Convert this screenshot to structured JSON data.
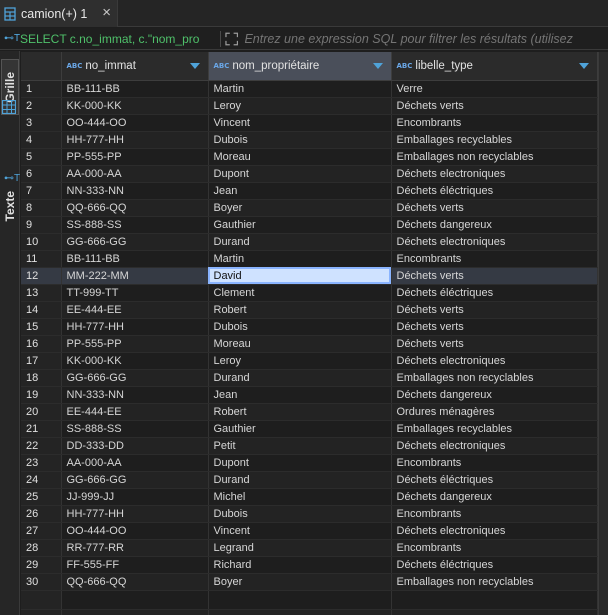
{
  "tab": {
    "label": "camion(+) 1",
    "close": "×"
  },
  "filter": {
    "query": "SELECT c.no_immat, c.\"nom_pro",
    "placeholder": "Entrez une expression SQL pour filtrer les résultats (utilisez",
    "sql_icon": "⊷T"
  },
  "side_tabs": {
    "grid": "Grille",
    "text": "Texte"
  },
  "columns": [
    {
      "name": "no_immat",
      "type_badge": "ABC",
      "selected": false
    },
    {
      "name": "nom_propriétaire",
      "type_badge": "ABC",
      "selected": true
    },
    {
      "name": "libelle_type",
      "type_badge": "ABC",
      "selected": false
    }
  ],
  "active_row": 12,
  "rows": [
    {
      "n": "1",
      "immat": "BB-111-BB",
      "owner": "Martin",
      "type": "Verre"
    },
    {
      "n": "2",
      "immat": "KK-000-KK",
      "owner": "Leroy",
      "type": "Déchets verts"
    },
    {
      "n": "3",
      "immat": "OO-444-OO",
      "owner": "Vincent",
      "type": "Encombrants"
    },
    {
      "n": "4",
      "immat": "HH-777-HH",
      "owner": "Dubois",
      "type": "Emballages recyclables"
    },
    {
      "n": "5",
      "immat": "PP-555-PP",
      "owner": "Moreau",
      "type": "Emballages non recyclables"
    },
    {
      "n": "6",
      "immat": "AA-000-AA",
      "owner": "Dupont",
      "type": "Déchets electroniques"
    },
    {
      "n": "7",
      "immat": "NN-333-NN",
      "owner": "Jean",
      "type": "Déchets éléctriques"
    },
    {
      "n": "8",
      "immat": "QQ-666-QQ",
      "owner": "Boyer",
      "type": "Déchets verts"
    },
    {
      "n": "9",
      "immat": "SS-888-SS",
      "owner": "Gauthier",
      "type": "Déchets dangereux"
    },
    {
      "n": "10",
      "immat": "GG-666-GG",
      "owner": "Durand",
      "type": "Déchets electroniques"
    },
    {
      "n": "11",
      "immat": "BB-111-BB",
      "owner": "Martin",
      "type": "Encombrants"
    },
    {
      "n": "12",
      "immat": "MM-222-MM",
      "owner": "David",
      "type": "Déchets verts"
    },
    {
      "n": "13",
      "immat": "TT-999-TT",
      "owner": "Clement",
      "type": "Déchets éléctriques"
    },
    {
      "n": "14",
      "immat": "EE-444-EE",
      "owner": "Robert",
      "type": "Déchets verts"
    },
    {
      "n": "15",
      "immat": "HH-777-HH",
      "owner": "Dubois",
      "type": "Déchets verts"
    },
    {
      "n": "16",
      "immat": "PP-555-PP",
      "owner": "Moreau",
      "type": "Déchets verts"
    },
    {
      "n": "17",
      "immat": "KK-000-KK",
      "owner": "Leroy",
      "type": "Déchets electroniques"
    },
    {
      "n": "18",
      "immat": "GG-666-GG",
      "owner": "Durand",
      "type": "Emballages non recyclables"
    },
    {
      "n": "19",
      "immat": "NN-333-NN",
      "owner": "Jean",
      "type": "Déchets dangereux"
    },
    {
      "n": "20",
      "immat": "EE-444-EE",
      "owner": "Robert",
      "type": "Ordures ménagères"
    },
    {
      "n": "21",
      "immat": "SS-888-SS",
      "owner": "Gauthier",
      "type": "Emballages recyclables"
    },
    {
      "n": "22",
      "immat": "DD-333-DD",
      "owner": "Petit",
      "type": "Déchets electroniques"
    },
    {
      "n": "23",
      "immat": "AA-000-AA",
      "owner": "Dupont",
      "type": "Encombrants"
    },
    {
      "n": "24",
      "immat": "GG-666-GG",
      "owner": "Durand",
      "type": "Déchets éléctriques"
    },
    {
      "n": "25",
      "immat": "JJ-999-JJ",
      "owner": "Michel",
      "type": "Déchets dangereux"
    },
    {
      "n": "26",
      "immat": "HH-777-HH",
      "owner": "Dubois",
      "type": "Encombrants"
    },
    {
      "n": "27",
      "immat": "OO-444-OO",
      "owner": "Vincent",
      "type": "Déchets electroniques"
    },
    {
      "n": "28",
      "immat": "RR-777-RR",
      "owner": "Legrand",
      "type": "Encombrants"
    },
    {
      "n": "29",
      "immat": "FF-555-FF",
      "owner": "Richard",
      "type": "Déchets éléctriques"
    },
    {
      "n": "30",
      "immat": "QQ-666-QQ",
      "owner": "Boyer",
      "type": "Emballages non recyclables"
    }
  ],
  "colors": {
    "accent": "#4fa3d9",
    "query": "#4fc06a",
    "focus_cell": "#cfe2ff"
  },
  "icons": {
    "tab": "table-icon",
    "close": "close-icon",
    "expand": "expand-icon",
    "grid": "grid-icon",
    "text": "text-icon",
    "sort": "sort-arrow-icon"
  }
}
